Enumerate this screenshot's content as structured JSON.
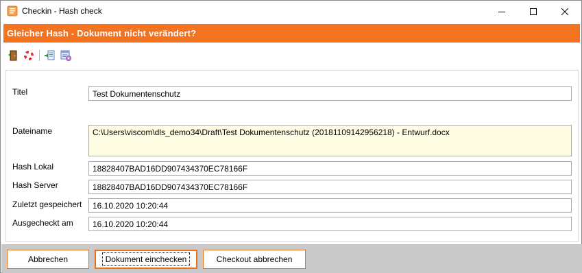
{
  "window": {
    "title": "Checkin - Hash check"
  },
  "header": {
    "title": "Gleicher Hash - Dokument nicht verändert?"
  },
  "toolbar": {
    "icons": [
      "door-exit-icon",
      "lifebuoy-icon",
      "document-import-icon",
      "form-settings-icon"
    ]
  },
  "form": {
    "titel_label": "Titel",
    "titel_value": "Test Dokumentenschutz",
    "dateiname_label": "Dateiname",
    "dateiname_value": "C:\\Users\\viscom\\dls_demo34\\Draft\\Test Dokumentenschutz (20181109142956218) - Entwurf.docx",
    "hash_lokal_label": "Hash Lokal",
    "hash_lokal_value": "18828407BAD16DD907434370EC78166F",
    "hash_server_label": "Hash Server",
    "hash_server_value": "18828407BAD16DD907434370EC78166F",
    "zuletzt_label": "Zuletzt gespeichert",
    "zuletzt_value": "16.10.2020 10:20:44",
    "ausgecheckt_label": "Ausgecheckt am",
    "ausgecheckt_value": "16.10.2020 10:20:44"
  },
  "buttons": {
    "abbrechen": "Abbrechen",
    "einchecken": "Dokument einchecken",
    "checkout_abbrechen": "Checkout abbrechen"
  },
  "colors": {
    "accent": "#f47321",
    "bottom_bar": "#c9c9c9",
    "multiline_field_bg": "#fefce2"
  }
}
